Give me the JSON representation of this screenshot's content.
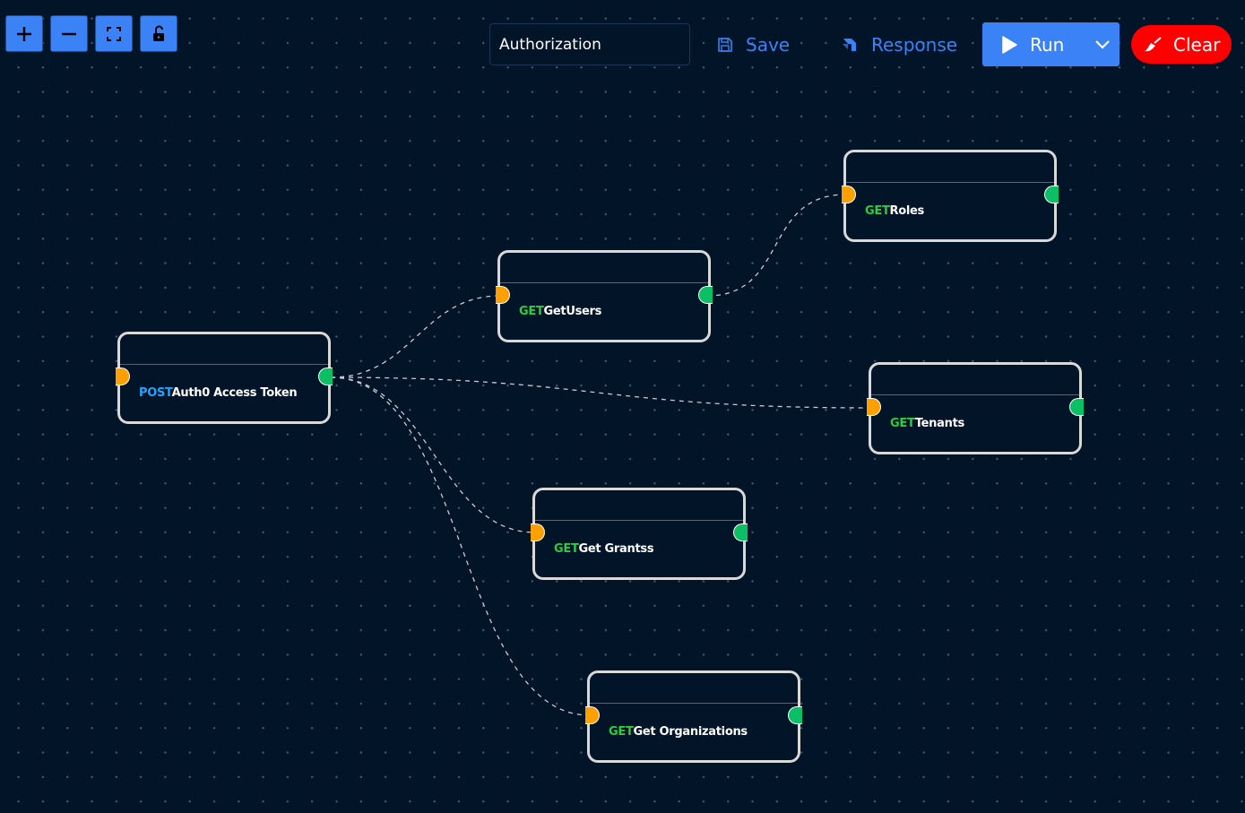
{
  "controls": {
    "zoom_in": "zoom-in",
    "zoom_out": "zoom-out",
    "fit_view": "fit-view",
    "lock": "unlocked"
  },
  "toolbar": {
    "workflow_name": "Authorization",
    "save_label": "Save",
    "response_label": "Response",
    "run_label": "Run",
    "clear_label": "Clear"
  },
  "colors": {
    "background": "#021427",
    "accent": "#3b82f6",
    "danger": "#ff0000",
    "get": "#2ecc40",
    "post": "#1ea7ff",
    "input_handle": "#ff9f00",
    "output_handle": "#0bbf64"
  },
  "nodes": [
    {
      "id": "auth0",
      "method": "POST",
      "name": "Auth0 Access Token"
    },
    {
      "id": "getusers",
      "method": "GET",
      "name": "GetUsers"
    },
    {
      "id": "roles",
      "method": "GET",
      "name": "Roles"
    },
    {
      "id": "tenants",
      "method": "GET",
      "name": "Tenants"
    },
    {
      "id": "grants",
      "method": "GET",
      "name": "Get Grantss"
    },
    {
      "id": "orgs",
      "method": "GET",
      "name": "Get Organizations"
    }
  ],
  "edges": [
    {
      "from": "auth0",
      "to": "getusers"
    },
    {
      "from": "auth0",
      "to": "tenants"
    },
    {
      "from": "auth0",
      "to": "grants"
    },
    {
      "from": "auth0",
      "to": "orgs"
    },
    {
      "from": "getusers",
      "to": "roles"
    }
  ]
}
